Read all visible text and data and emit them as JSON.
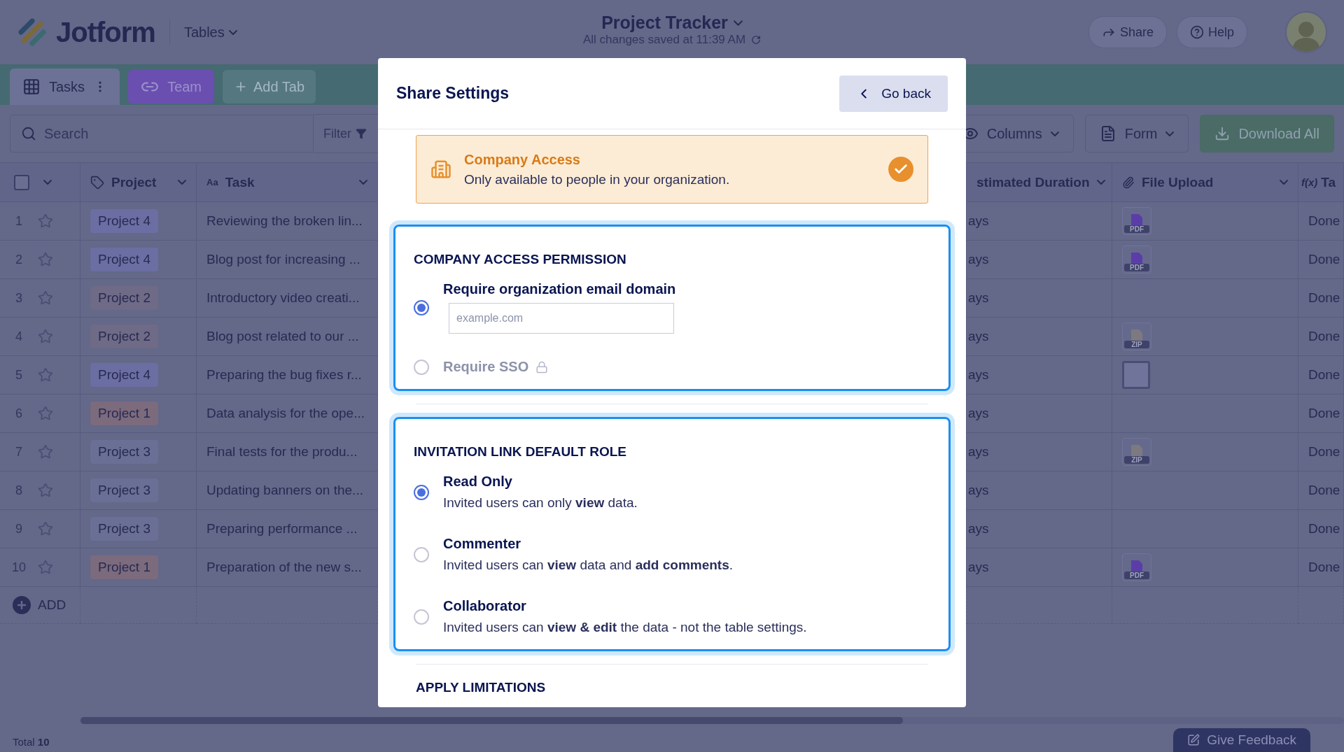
{
  "app": {
    "logo": "Jotform",
    "menu": "Tables"
  },
  "document": {
    "title": "Project Tracker",
    "status": "All changes saved at 11:39 AM"
  },
  "header_actions": [
    {
      "label": "Share",
      "kind": "share"
    },
    {
      "label": "Help",
      "kind": "help"
    }
  ],
  "tabs": [
    {
      "label": "Tasks",
      "selected": true,
      "kind": "grid",
      "color": "#6c7296"
    },
    {
      "label": "Team",
      "selected": false,
      "kind": "link",
      "color": "#6a4fb0"
    }
  ],
  "add_tab": "Add Tab",
  "search": {
    "placeholder": "Search"
  },
  "filter": "Filter",
  "toolbar_buttons": [
    {
      "label": "Columns",
      "kind": "columns"
    },
    {
      "label": "Form",
      "kind": "form"
    },
    {
      "label": "Download All",
      "kind": "download"
    }
  ],
  "table": {
    "select_all": {
      "checked": false
    },
    "columns": [
      {
        "label": "Project",
        "kind": "tag"
      },
      {
        "label": "Task",
        "kind": "text",
        "icon": "Aa"
      },
      {
        "label": "stimated Duration",
        "kind": "duration"
      },
      {
        "label": "File Upload",
        "kind": "file"
      },
      {
        "label": "Ta",
        "kind": "formula",
        "icon": "f(x)"
      }
    ],
    "rows": [
      {
        "number": "1",
        "project": "Project 4",
        "color": "#6b6ea2",
        "task": "Reviewing the broken lin...",
        "duration": "ays",
        "file": {
          "kind": "doc",
          "label": "PDF"
        },
        "status": "Done"
      },
      {
        "number": "2",
        "project": "Project 4",
        "color": "#6b6ea2",
        "task": "Blog post for increasing ...",
        "duration": "ays",
        "file": {
          "kind": "doc",
          "label": "PDF"
        },
        "status": "Done"
      },
      {
        "number": "3",
        "project": "Project 2",
        "color": "#6f6a86",
        "task": "Introductory video creati...",
        "duration": "ays",
        "status": "Done"
      },
      {
        "number": "4",
        "project": "Project 2",
        "color": "#6f6a86",
        "task": "Blog post related to our ...",
        "duration": "ays",
        "file": {
          "kind": "archive",
          "label": "ZIP"
        },
        "status": "Done"
      },
      {
        "number": "5",
        "project": "Project 4",
        "color": "#6b6ea2",
        "task": "Preparing the bug fixes r...",
        "duration": "ays",
        "file": {
          "kind": "image"
        },
        "status": "Done"
      },
      {
        "number": "6",
        "project": "Project 1",
        "color": "#7c6a7d",
        "task": "Data analysis for the ope...",
        "duration": "ays",
        "status": "Done"
      },
      {
        "number": "7",
        "project": "Project 3",
        "color": "#6a6f96",
        "task": "Final tests for the produ...",
        "duration": "ays",
        "file": {
          "kind": "archive",
          "label": "ZIP"
        },
        "status": "Done"
      },
      {
        "number": "8",
        "project": "Project 3",
        "color": "#6a6f96",
        "task": "Updating banners on the...",
        "duration": "ays",
        "status": "Done"
      },
      {
        "number": "9",
        "project": "Project 3",
        "color": "#6a6f96",
        "task": "Preparing performance ...",
        "duration": "ays",
        "status": "Done"
      },
      {
        "number": "10",
        "project": "Project 1",
        "color": "#7c6a7d",
        "task": "Preparation of the new s...",
        "duration": "ays",
        "file": {
          "kind": "doc",
          "label": "PDF"
        },
        "status": "Done"
      }
    ],
    "add": "ADD"
  },
  "total": "Total **10**",
  "feedback": "Give Feedback",
  "modal": {
    "title": "Share Settings",
    "back": "Go back",
    "banner": {
      "title": "Company Access",
      "text": "Only available to people in your organization.",
      "checked": true
    },
    "sections": [
      {
        "heading": "COMPANY ACCESS PERMISSION",
        "options": [
          {
            "label": "Require organization email domain",
            "selected": true,
            "disabled": false,
            "field": {
              "placeholder": "example.com"
            }
          },
          {
            "label": "Require SSO",
            "selected": false,
            "disabled": true,
            "locked": true
          }
        ]
      },
      {
        "heading": "INVITATION LINK DEFAULT ROLE",
        "options": [
          {
            "label": "Read Only",
            "description": "Invited users can only **view** data.",
            "selected": true,
            "disabled": false
          },
          {
            "label": "Commenter",
            "description": "Invited users can **view** data and **add comments**.",
            "selected": false,
            "disabled": false
          },
          {
            "label": "Collaborator",
            "description": "Invited users can **view & edit** the data - not the table settings.",
            "selected": false,
            "disabled": false
          }
        ]
      }
    ],
    "next_heading": "APPLY LIMITATIONS"
  }
}
